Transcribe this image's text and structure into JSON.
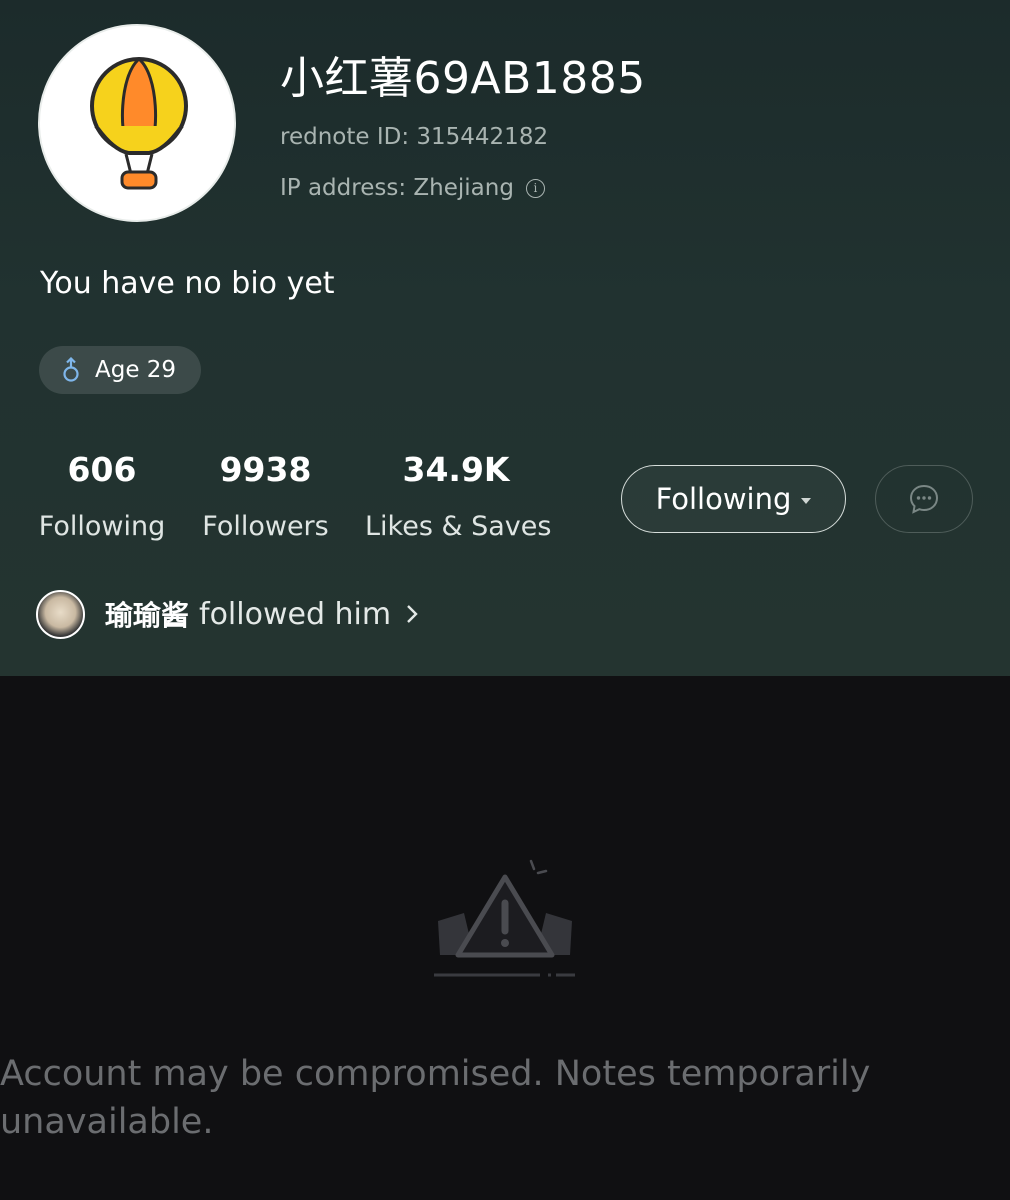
{
  "profile": {
    "username": "小红薯69AB1885",
    "rednote_id": "rednote ID: 315442182",
    "ip_address": "IP address: Zhejiang",
    "bio": "You have no bio yet",
    "tag": {
      "icon": "male-icon",
      "label": "Age 29"
    },
    "stats": [
      {
        "value": "606",
        "label": "Following"
      },
      {
        "value": "9938",
        "label": "Followers"
      },
      {
        "value": "34.9K",
        "label": "Likes & Saves"
      }
    ],
    "follow_button_label": "Following",
    "message_button_icon": "chat-bubble-icon",
    "mutual": {
      "name": "瑜瑜酱",
      "text": "followed him"
    }
  },
  "notice": {
    "icon": "warning-icon",
    "text": "Account may be compromised. Notes temporarily unavailable."
  },
  "colors": {
    "header_background": "#213230",
    "page_background": "#101012",
    "avatar_balloon": "#f6d21c",
    "avatar_balloon_stripe": "#ff8a2a",
    "muted_text": "#6b6d70"
  }
}
